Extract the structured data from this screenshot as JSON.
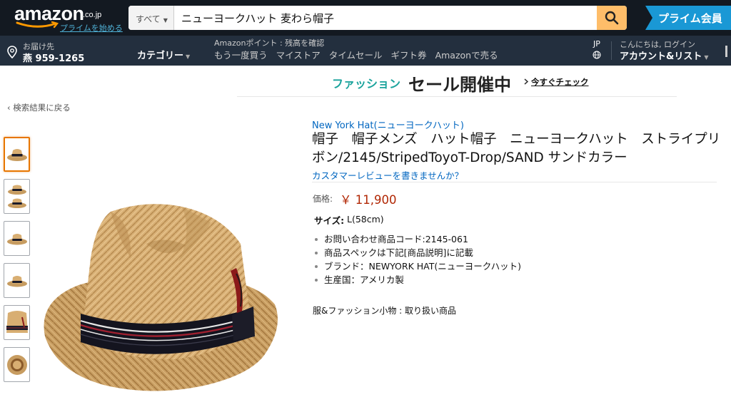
{
  "header": {
    "logo_text": "amazon",
    "logo_suffix": ".co.jp",
    "prime_link": "プライムを始める",
    "search_category": "すべて",
    "search_value": "ニューヨークハット 麦わら帽子",
    "prime_banner": "プライム会員"
  },
  "subnav": {
    "deliver_line1": "お届け先",
    "deliver_line2": "燕 959-1265",
    "category": "カテゴリー",
    "points": "Amazonポイント : 残高を確認",
    "links": [
      "もう一度買う",
      "マイストア",
      "タイムセール",
      "ギフト券",
      "Amazonで売る"
    ],
    "lang": "JP",
    "account_line1": "こんにちは, ログイン",
    "account_line2": "アカウント&リスト"
  },
  "promo": {
    "fashion": "ファッション",
    "sale": "セール開催中",
    "check": "今すぐチェック"
  },
  "back_link": "‹ 検索結果に戻る",
  "product": {
    "brand": "New York Hat(ニューヨークハット)",
    "title": "帽子　帽子メンズ　ハット帽子　ニューヨークハット　ストライプリボン/2145/StripedToyoT-Drop/SAND サンドカラー",
    "review_link": "カスタマーレビューを書きませんか？",
    "price_label": "価格:",
    "price": "￥ 11,900",
    "size_label": "サイズ:",
    "size_value": "L(58cm)",
    "bullets": [
      "お問い合わせ商品コード:2145-061",
      "商品スペックは下記[商品説明]に記載",
      "ブランド：NEWYORK HAT(ニューヨークハット)",
      "生産国：アメリカ製"
    ],
    "category_line": "服&ファッション小物 : 取り扱い商品"
  },
  "colors": {
    "nav_dark": "#131921",
    "nav_secondary": "#232f3e",
    "search_button": "#febd69",
    "link_blue": "#0066c0",
    "price_red": "#b12704",
    "fashion_teal": "#1aa39c",
    "prime_blue": "#1a98d5",
    "straw": "#d8ae72"
  },
  "icons": [
    "search-icon",
    "location-pin-icon",
    "globe-icon",
    "chevron-right-icon",
    "caret-down-icon"
  ]
}
